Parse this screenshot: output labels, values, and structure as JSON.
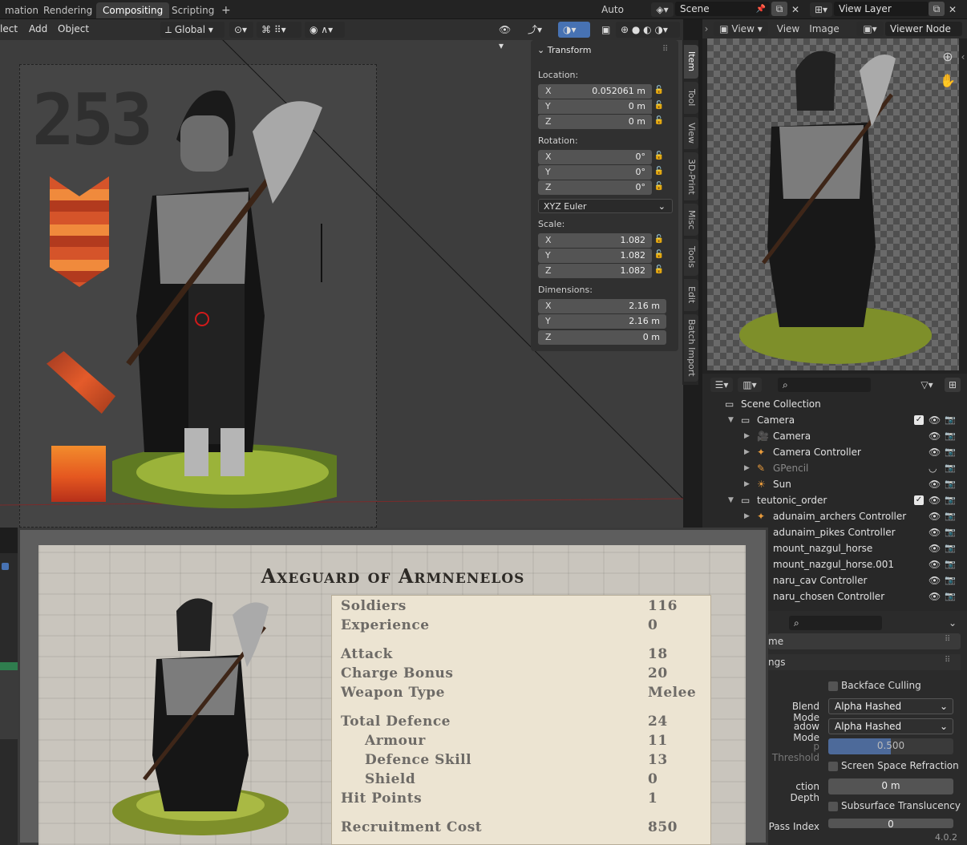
{
  "topbar": {
    "tabs": [
      "mation",
      "Rendering",
      "Compositing",
      "Scripting"
    ],
    "active_tab": "Compositing",
    "add_tab": "+",
    "auto_reload": "Auto Reload",
    "scene": "Scene",
    "view_layer": "View Layer"
  },
  "viewport": {
    "menus": [
      "lect",
      "Add",
      "Object"
    ],
    "orientation": "Global",
    "watermark": "253",
    "panel_title": "Transform",
    "location_label": "Location:",
    "location": [
      {
        "axis": "X",
        "value": "0.052061 m"
      },
      {
        "axis": "Y",
        "value": "0 m"
      },
      {
        "axis": "Z",
        "value": "0 m"
      }
    ],
    "rotation_label": "Rotation:",
    "rotation": [
      {
        "axis": "X",
        "value": "0°"
      },
      {
        "axis": "Y",
        "value": "0°"
      },
      {
        "axis": "Z",
        "value": "0°"
      }
    ],
    "rotation_mode": "XYZ Euler",
    "scale_label": "Scale:",
    "scale": [
      {
        "axis": "X",
        "value": "1.082"
      },
      {
        "axis": "Y",
        "value": "1.082"
      },
      {
        "axis": "Z",
        "value": "1.082"
      }
    ],
    "dimensions_label": "Dimensions:",
    "dimensions": [
      {
        "axis": "X",
        "value": "2.16 m"
      },
      {
        "axis": "Y",
        "value": "2.16 m"
      },
      {
        "axis": "Z",
        "value": "0 m"
      }
    ],
    "side_tabs": [
      "Item",
      "Tool",
      "View",
      "3D-Print",
      "Misc",
      "Tools",
      "Edit",
      "Batch Import"
    ]
  },
  "image_editor": {
    "view_menu": "View",
    "menus": [
      "View",
      "Image"
    ],
    "viewer_node": "Viewer Node"
  },
  "outliner": {
    "rows": [
      {
        "name": "Scene Collection",
        "indent": 0,
        "icon": "collection-icon"
      },
      {
        "name": "Camera",
        "indent": 1,
        "icon": "collection-icon",
        "check": true
      },
      {
        "name": "Camera",
        "indent": 2,
        "icon": "camera-icon"
      },
      {
        "name": "Camera Controller",
        "indent": 2,
        "icon": "armature-icon"
      },
      {
        "name": "GPencil",
        "indent": 2,
        "icon": "gpencil-icon",
        "dim": true
      },
      {
        "name": "Sun",
        "indent": 2,
        "icon": "light-icon"
      },
      {
        "name": "teutonic_order",
        "indent": 1,
        "icon": "collection-icon",
        "check": true
      },
      {
        "name": "adunaim_archers Controller",
        "indent": 2,
        "icon": "armature-icon"
      },
      {
        "name": "adunaim_pikes Controller",
        "indent": 2,
        "icon": "armature-icon"
      },
      {
        "name": "mount_nazgul_horse",
        "indent": 2,
        "icon": "armature-icon"
      },
      {
        "name": "mount_nazgul_horse.001",
        "indent": 2,
        "icon": "armature-icon"
      },
      {
        "name": "naru_cav Controller",
        "indent": 2,
        "icon": "armature-icon"
      },
      {
        "name": "naru_chosen Controller",
        "indent": 2,
        "icon": "armature-icon"
      }
    ]
  },
  "properties": {
    "section1": "me",
    "section2": "ngs",
    "backface": "Backface Culling",
    "blend_mode_label": "Blend Mode",
    "blend_mode": "Alpha Hashed",
    "shadow_mode_label": "adow Mode",
    "shadow_mode": "Alpha Hashed",
    "threshold_label": "p Threshold",
    "threshold": "0.500",
    "ssr": "Screen Space Refraction",
    "depth_label": "ction Depth",
    "depth": "0 m",
    "subsurface": "Subsurface Translucency",
    "pass_label": "Pass Index",
    "pass": "0",
    "version": "4.0.2"
  },
  "unit_card": {
    "title": "Axeguard of Armnenelos",
    "stats": [
      {
        "label": "Soldiers",
        "value": "116",
        "indent": false,
        "gap": false
      },
      {
        "label": "Experience",
        "value": "0",
        "indent": false,
        "gap": false
      },
      {
        "label": "Attack",
        "value": "18",
        "indent": false,
        "gap": true
      },
      {
        "label": "Charge Bonus",
        "value": "20",
        "indent": false,
        "gap": false
      },
      {
        "label": "Weapon Type",
        "value": "Melee",
        "indent": false,
        "gap": false
      },
      {
        "label": "Total Defence",
        "value": "24",
        "indent": false,
        "gap": true
      },
      {
        "label": "Armour",
        "value": "11",
        "indent": true,
        "gap": false
      },
      {
        "label": "Defence Skill",
        "value": "13",
        "indent": true,
        "gap": false
      },
      {
        "label": "Shield",
        "value": "0",
        "indent": true,
        "gap": false
      },
      {
        "label": "Hit Points",
        "value": "1",
        "indent": false,
        "gap": false
      },
      {
        "label": "Recruitment Cost",
        "value": "850",
        "indent": false,
        "gap": true
      }
    ]
  },
  "colors": {
    "accent": "#4772b3",
    "selection": "#ff7f00",
    "panel": "#303030"
  }
}
